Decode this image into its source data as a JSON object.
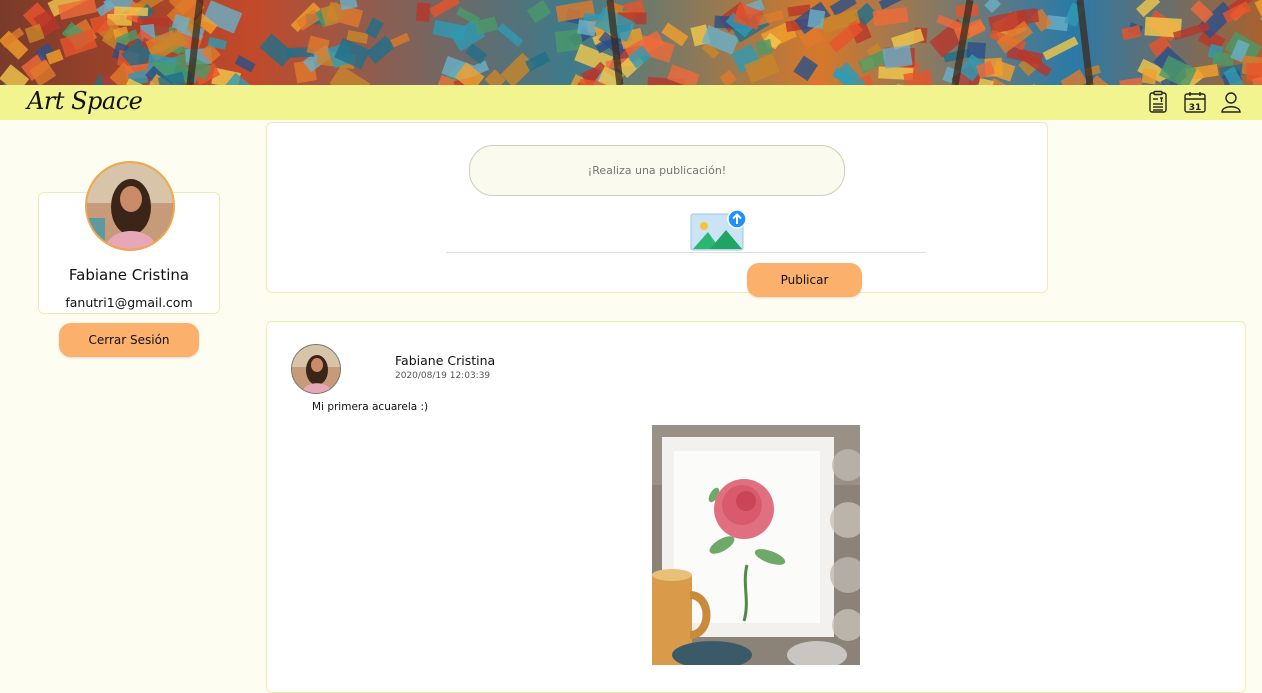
{
  "app": {
    "brand": "Art Space"
  },
  "nav": {
    "icons": [
      {
        "name": "notes-icon"
      },
      {
        "name": "calendar-icon",
        "label": "31"
      },
      {
        "name": "user-icon"
      }
    ]
  },
  "profile": {
    "name": "Fabiane Cristina",
    "email": "fanutri1@gmail.com",
    "logout_label": "Cerrar Sesión"
  },
  "composer": {
    "placeholder": "¡Realiza una publicación!",
    "upload_icon": "image-upload-icon",
    "publish_label": "Publicar"
  },
  "post": {
    "author": "Fabiane Cristina",
    "date": "2020/08/19 12:03:39",
    "text": "Mi primera acuarela :)"
  },
  "colors": {
    "navbar": "#f2f48f",
    "accent_button": "#fbb06c",
    "page_background": "#fdfdf2",
    "card_border": "#f0ecb0"
  }
}
